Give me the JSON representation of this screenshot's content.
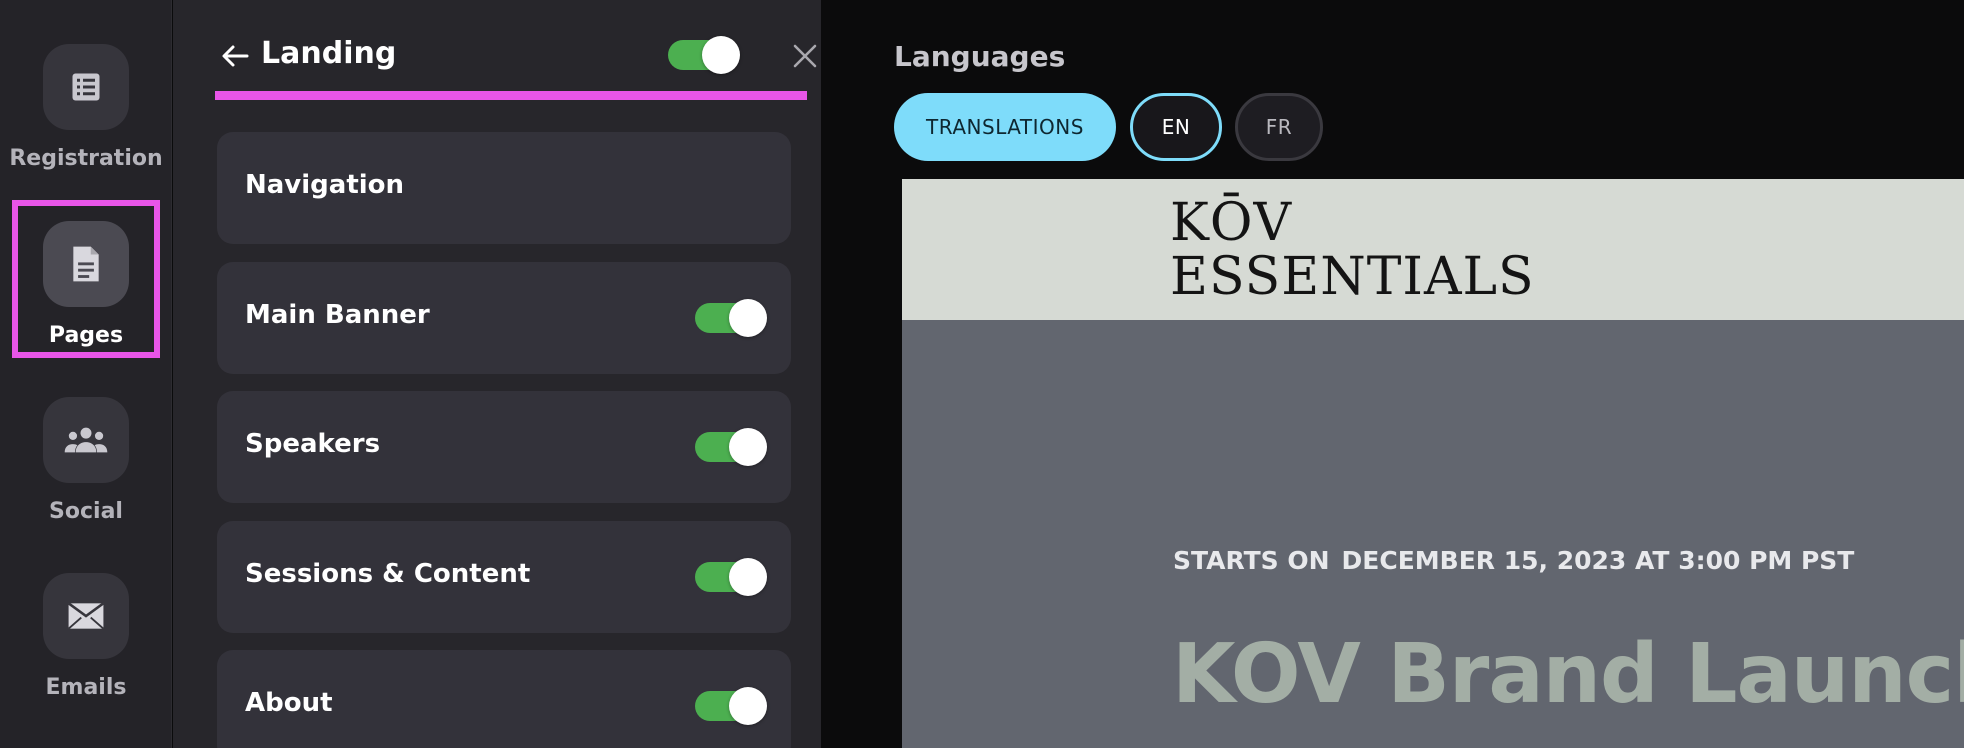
{
  "rail": {
    "items": [
      {
        "label": "Registration",
        "icon": "list-icon"
      },
      {
        "label": "Pages",
        "icon": "page-icon",
        "active": true
      },
      {
        "label": "Social",
        "icon": "people-icon"
      },
      {
        "label": "Emails",
        "icon": "mail-icon"
      }
    ]
  },
  "panel": {
    "title": "Landing",
    "enabled": true,
    "sections": [
      {
        "label": "Navigation",
        "has_toggle": false
      },
      {
        "label": "Main Banner",
        "has_toggle": true,
        "enabled": true
      },
      {
        "label": "Speakers",
        "has_toggle": true,
        "enabled": true
      },
      {
        "label": "Sessions & Content",
        "has_toggle": true,
        "enabled": true
      },
      {
        "label": "About",
        "has_toggle": true,
        "enabled": true
      }
    ]
  },
  "languages": {
    "title": "Languages",
    "translations_label": "TRANSLATIONS",
    "options": [
      "EN",
      "FR"
    ],
    "selected": "EN"
  },
  "preview": {
    "logo_line1": "KŌV",
    "logo_line2": "ESSENTIALS",
    "starts_label": "STARTS ON",
    "starts_value": "DECEMBER 15, 2023 AT 3:00 PM PST",
    "event_title": "KOV Brand Launch"
  },
  "colors": {
    "accent_highlight": "#e855e8",
    "toggle_on": "#4caf50",
    "pill_accent": "#7edcfa"
  }
}
